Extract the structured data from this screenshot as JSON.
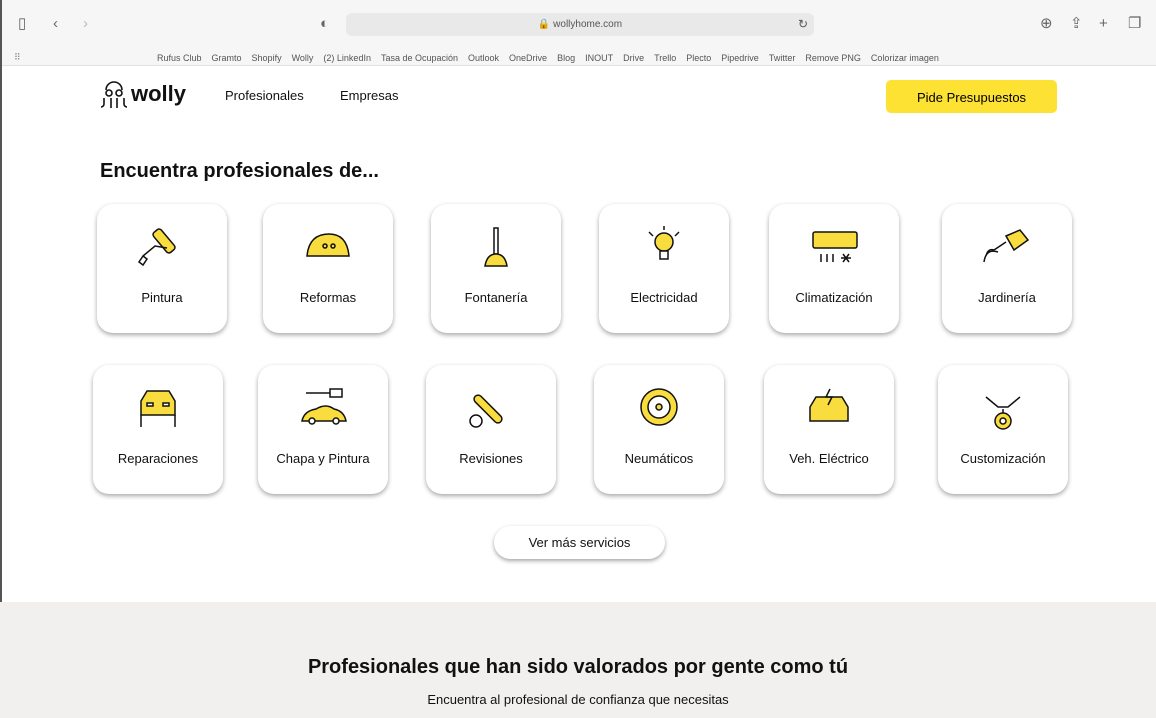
{
  "browser": {
    "url": "wollyhome.com",
    "bookmarks": [
      "Rufus Club",
      "Gramto",
      "Shopify",
      "Wolly",
      "(2) LinkedIn",
      "Tasa de Ocupación",
      "Outlook",
      "OneDrive",
      "Blog",
      "INOUT",
      "Drive",
      "Trello",
      "Plecto",
      "Pipedrive",
      "Twitter",
      "Remove PNG",
      "Colorizar imagen"
    ]
  },
  "header": {
    "logo": "wolly",
    "nav": [
      "Profesionales",
      "Empresas"
    ],
    "cta": "Pide Presupuestos"
  },
  "section": {
    "title": "Encuentra profesionales de...",
    "more": "Ver más servicios"
  },
  "services": [
    {
      "label": "Pintura",
      "icon": "paint-roller-icon"
    },
    {
      "label": "Reformas",
      "icon": "hard-hat-icon"
    },
    {
      "label": "Fontanería",
      "icon": "plunger-icon"
    },
    {
      "label": "Electricidad",
      "icon": "lightbulb-icon"
    },
    {
      "label": "Climatización",
      "icon": "air-conditioner-icon"
    },
    {
      "label": "Jardinería",
      "icon": "watering-can-icon"
    },
    {
      "label": "Reparaciones",
      "icon": "car-lift-icon"
    },
    {
      "label": "Chapa y Pintura",
      "icon": "car-paint-icon"
    },
    {
      "label": "Revisiones",
      "icon": "wrench-icon"
    },
    {
      "label": "Neumáticos",
      "icon": "steering-wheel-icon"
    },
    {
      "label": "Veh. Eléctrico",
      "icon": "electric-car-icon"
    },
    {
      "label": "Customización",
      "icon": "engine-icon"
    }
  ],
  "reviews": {
    "title": "Profesionales que han sido valorados por gente como tú",
    "subtitle": "Encuentra al profesional de confianza que necesitas"
  },
  "colors": {
    "accent": "#fde234",
    "icon_fill": "#f9dc3d"
  }
}
